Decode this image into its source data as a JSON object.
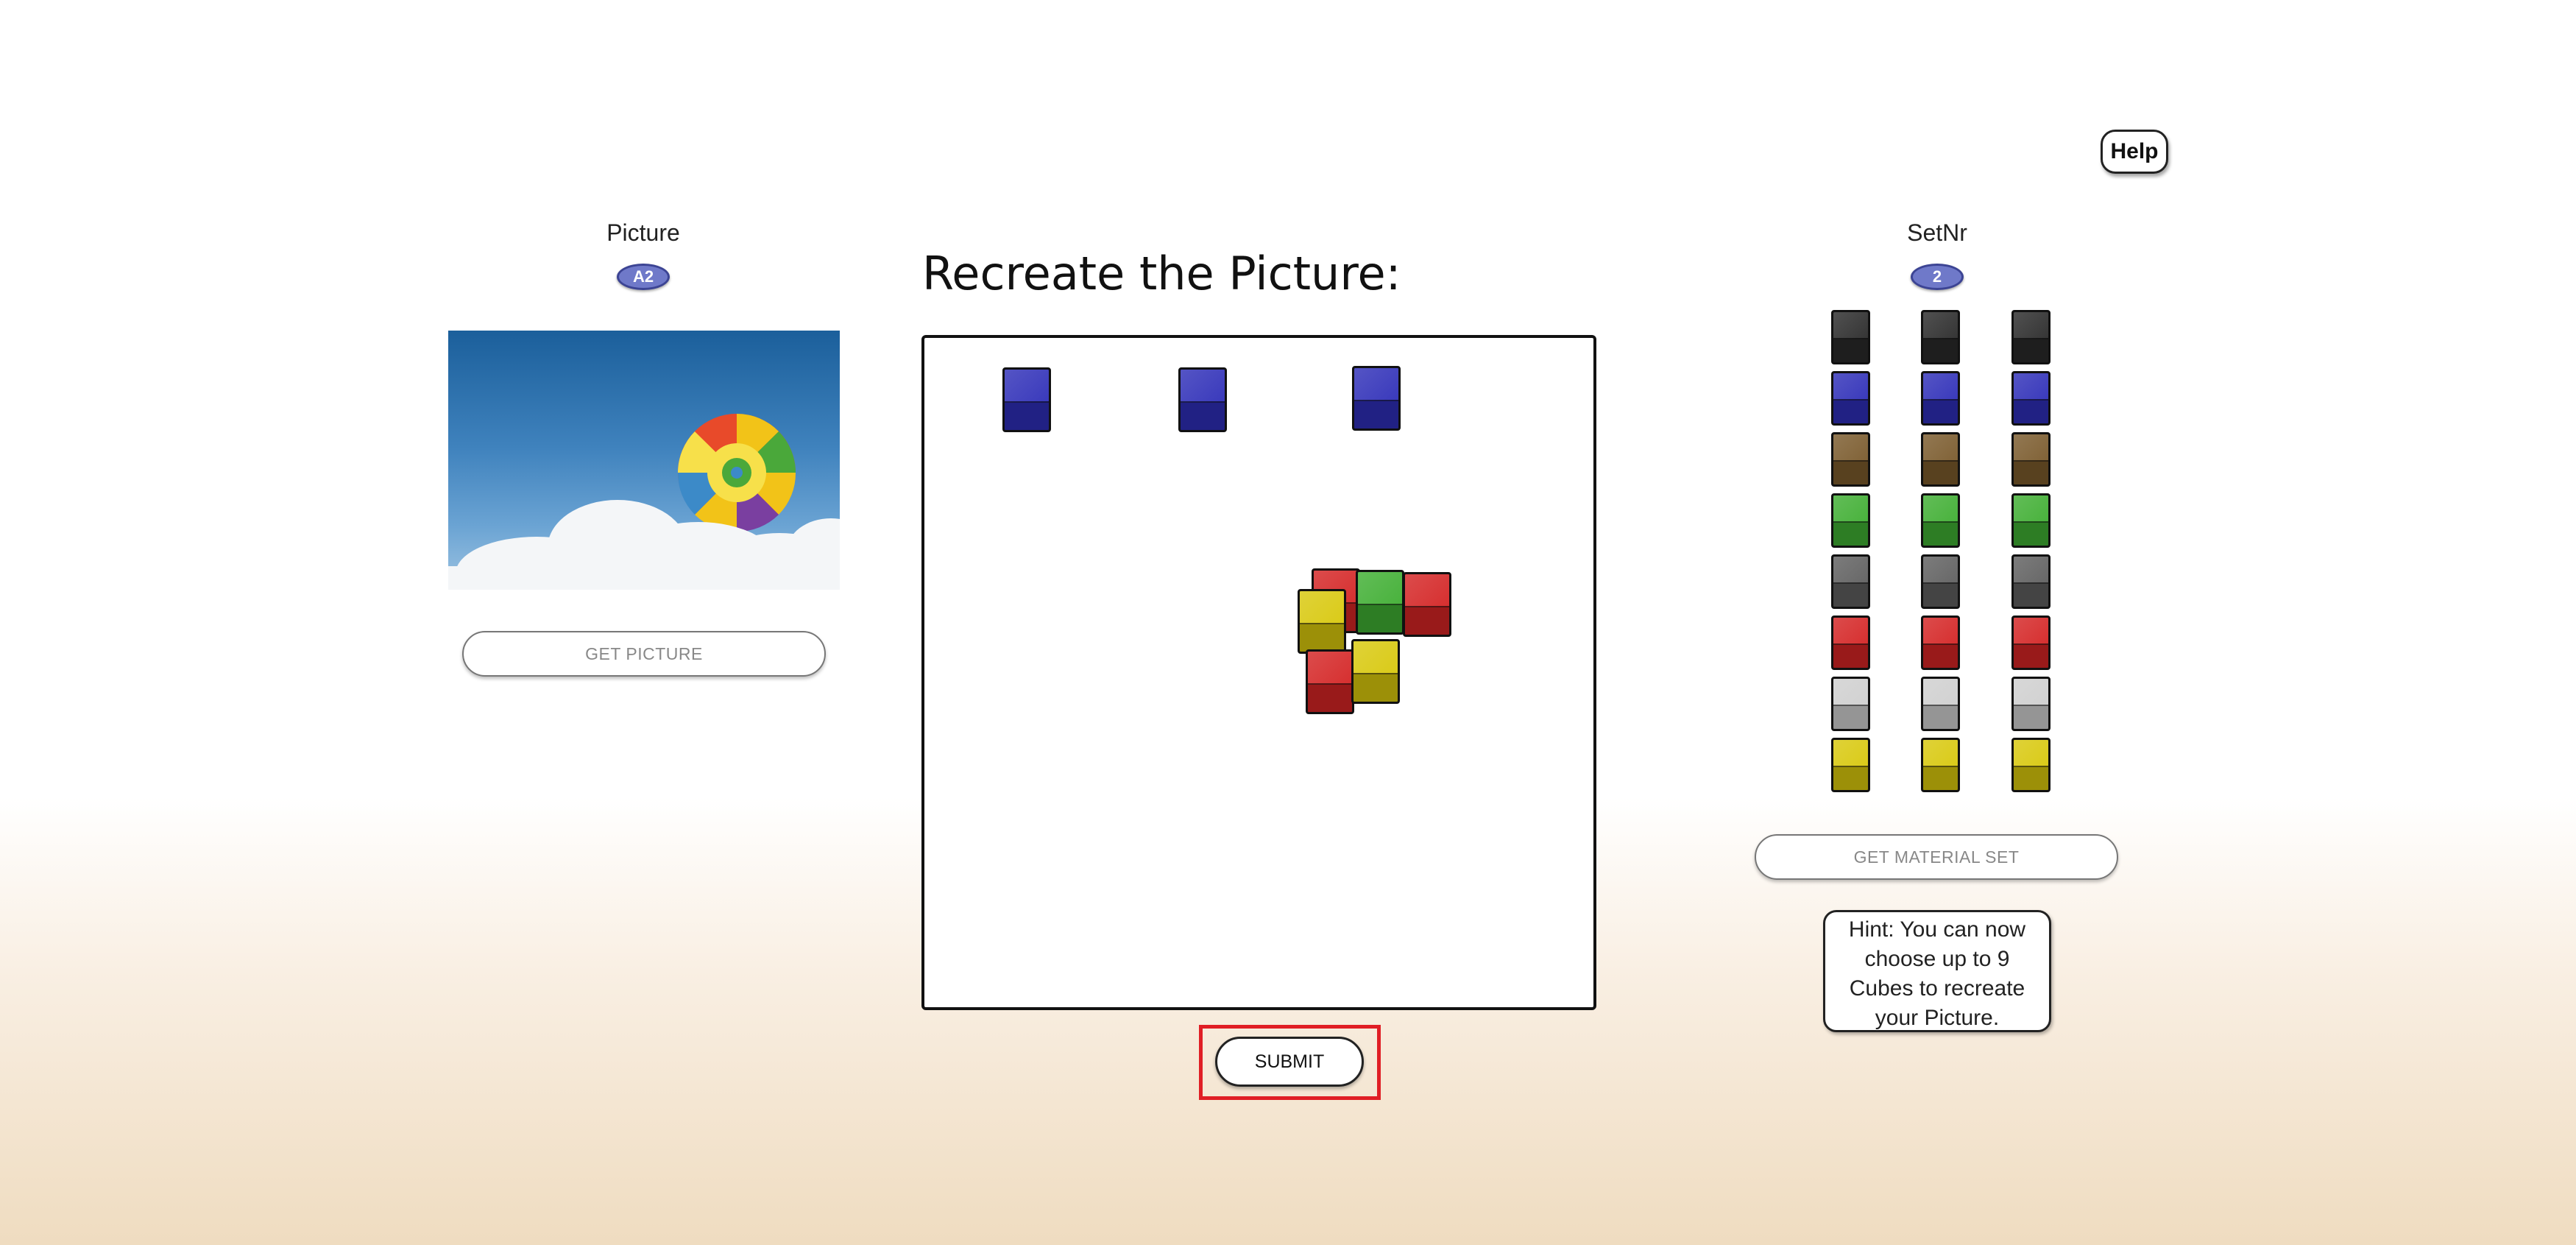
{
  "help_label": "Help",
  "picture_panel": {
    "label": "Picture",
    "badge": "A2",
    "get_button": "GET PICTURE"
  },
  "workspace": {
    "title": "Recreate the Picture:",
    "submit_label": "SUBMIT"
  },
  "material_panel": {
    "label": "SetNr",
    "badge": "2",
    "get_button": "GET MATERIAL SET",
    "palette_rows": [
      "black",
      "blue",
      "brown",
      "green",
      "gray",
      "red",
      "light-gray",
      "yellow"
    ],
    "hint": "Hint: You can now choose up to 9 Cubes to recreate your Picture."
  },
  "colors": {
    "black": "#2a2a2a",
    "blue": "#2f2fb8",
    "brown": "#7a5a2c",
    "green": "#3fae32",
    "gray": "#5f5f5f",
    "red": "#d42424",
    "light-gray": "#cfcfcf",
    "yellow": "#d8c80c",
    "badge": "#6f79c9",
    "submit_highlight": "#e01e25"
  },
  "placed_cubes": [
    "blue",
    "blue",
    "blue",
    "red",
    "green",
    "red",
    "yellow",
    "yellow",
    "red"
  ]
}
